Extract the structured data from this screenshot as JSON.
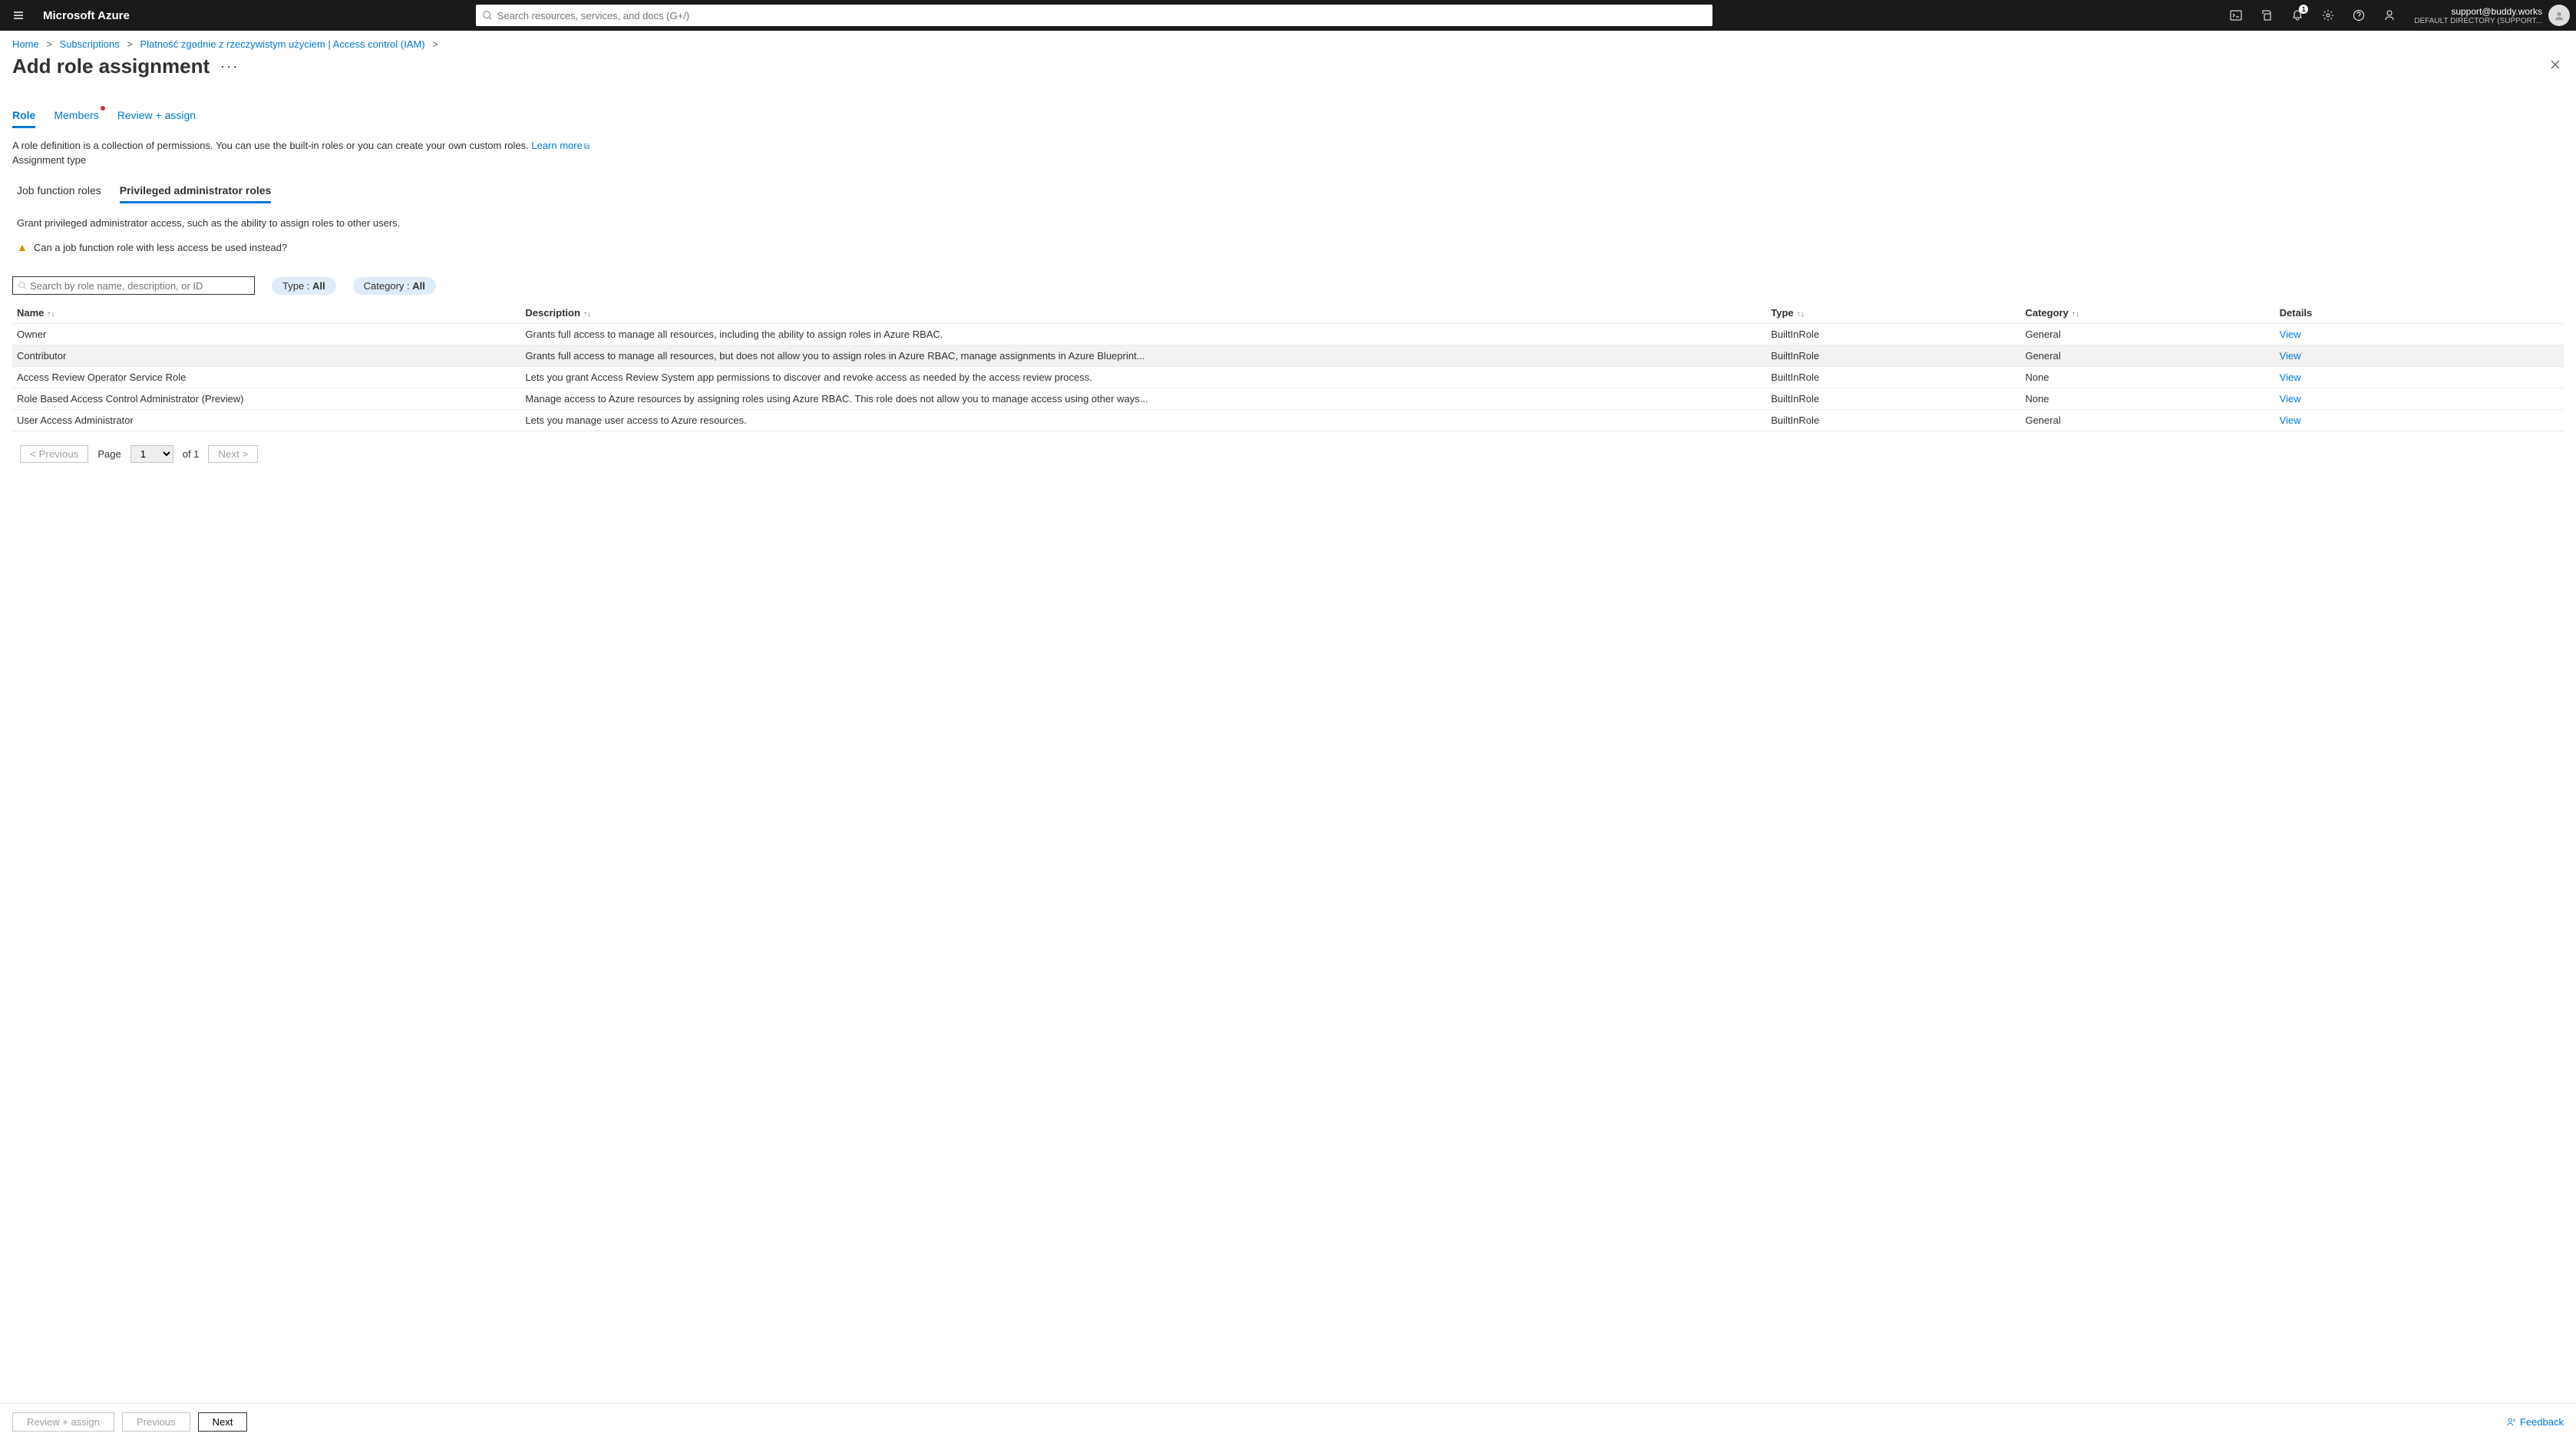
{
  "topbar": {
    "brand": "Microsoft Azure",
    "search_placeholder": "Search resources, services, and docs (G+/)",
    "notification_count": "1",
    "account_email": "support@buddy.works",
    "account_directory": "DEFAULT DIRECTORY (SUPPORT..."
  },
  "breadcrumbs": [
    "Home",
    "Subscriptions",
    "Płatność zgodnie z rzeczywistym użyciem | Access control (IAM)"
  ],
  "page_title": "Add role assignment",
  "steps": {
    "role": "Role",
    "members": "Members",
    "review": "Review + assign"
  },
  "intro_text": "A role definition is a collection of permissions. You can use the built-in roles or you can create your own custom roles. ",
  "learn_more": "Learn more",
  "assignment_type_label": "Assignment type",
  "subtabs": {
    "job": "Job function roles",
    "priv": "Privileged administrator roles"
  },
  "desc2": "Grant privileged administrator access, such as the ability to assign roles to other users.",
  "warn_text": "Can a job function role with less access be used instead?",
  "search_roles_placeholder": "Search by role name, description, or ID",
  "pill_type_label": "Type : ",
  "pill_type_value": "All",
  "pill_cat_label": "Category : ",
  "pill_cat_value": "All",
  "columns": {
    "name": "Name",
    "description": "Description",
    "type": "Type",
    "category": "Category",
    "details": "Details"
  },
  "rows": [
    {
      "name": "Owner",
      "desc": "Grants full access to manage all resources, including the ability to assign roles in Azure RBAC.",
      "type": "BuiltInRole",
      "category": "General",
      "details": "View"
    },
    {
      "name": "Contributor",
      "desc": "Grants full access to manage all resources, but does not allow you to assign roles in Azure RBAC, manage assignments in Azure Blueprint...",
      "type": "BuiltInRole",
      "category": "General",
      "details": "View",
      "hover": true
    },
    {
      "name": "Access Review Operator Service Role",
      "desc": "Lets you grant Access Review System app permissions to discover and revoke access as needed by the access review process.",
      "type": "BuiltInRole",
      "category": "None",
      "details": "View"
    },
    {
      "name": "Role Based Access Control Administrator (Preview)",
      "desc": "Manage access to Azure resources by assigning roles using Azure RBAC. This role does not allow you to manage access using other ways...",
      "type": "BuiltInRole",
      "category": "None",
      "details": "View"
    },
    {
      "name": "User Access Administrator",
      "desc": "Lets you manage user access to Azure resources.",
      "type": "BuiltInRole",
      "category": "General",
      "details": "View"
    }
  ],
  "pager": {
    "prev": "< Previous",
    "page_label": "Page",
    "page": "1",
    "of": "of 1",
    "next": "Next >"
  },
  "footer": {
    "review": "Review + assign",
    "previous": "Previous",
    "next": "Next",
    "feedback": "Feedback"
  }
}
